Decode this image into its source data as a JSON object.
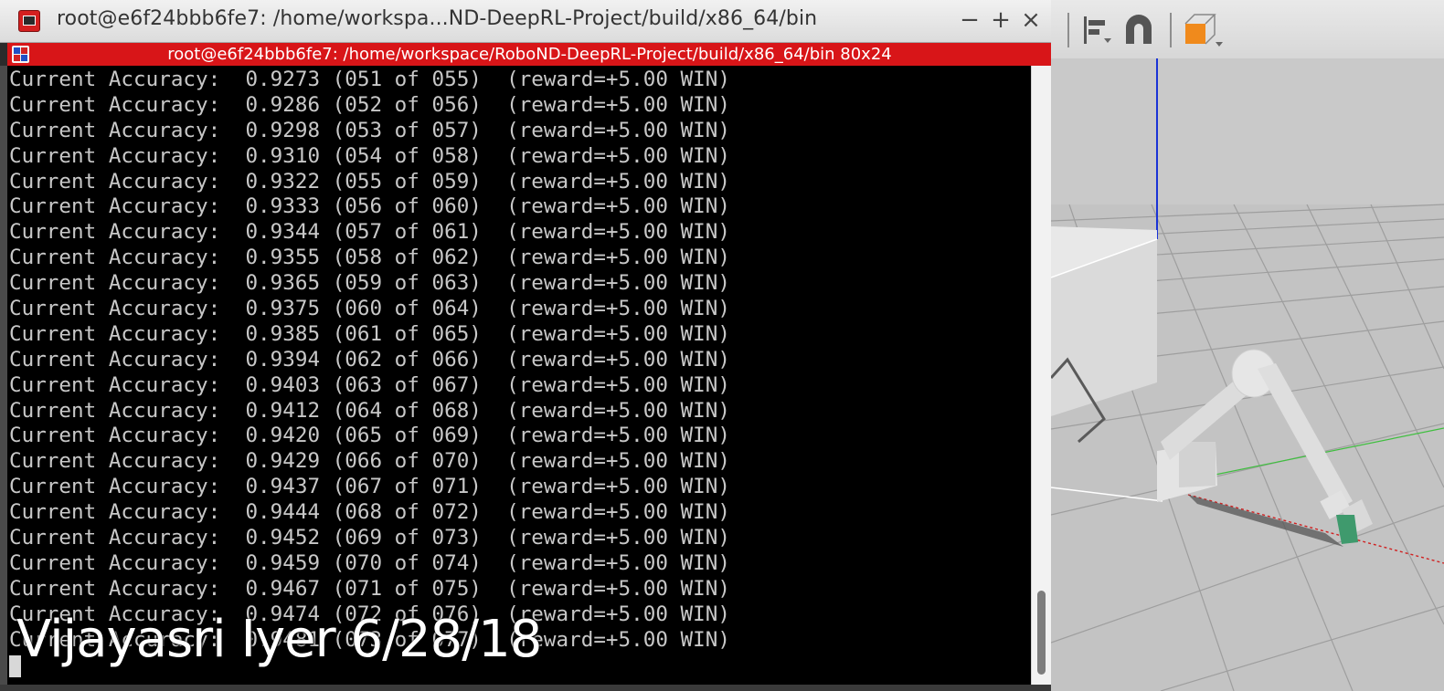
{
  "terminal": {
    "window_title": "root@e6f24bbb6fe7: /home/workspa...ND-DeepRL-Project/build/x86_64/bin",
    "controls": {
      "minimize": "−",
      "maximize": "+",
      "close": "×"
    },
    "tab_title": "root@e6f24bbb6fe7: /home/workspace/RoboND-DeepRL-Project/build/x86_64/bin 80x24",
    "lines": [
      "Current Accuracy:  0.9273 (051 of 055)  (reward=+5.00 WIN)",
      "Current Accuracy:  0.9286 (052 of 056)  (reward=+5.00 WIN)",
      "Current Accuracy:  0.9298 (053 of 057)  (reward=+5.00 WIN)",
      "Current Accuracy:  0.9310 (054 of 058)  (reward=+5.00 WIN)",
      "Current Accuracy:  0.9322 (055 of 059)  (reward=+5.00 WIN)",
      "Current Accuracy:  0.9333 (056 of 060)  (reward=+5.00 WIN)",
      "Current Accuracy:  0.9344 (057 of 061)  (reward=+5.00 WIN)",
      "Current Accuracy:  0.9355 (058 of 062)  (reward=+5.00 WIN)",
      "Current Accuracy:  0.9365 (059 of 063)  (reward=+5.00 WIN)",
      "Current Accuracy:  0.9375 (060 of 064)  (reward=+5.00 WIN)",
      "Current Accuracy:  0.9385 (061 of 065)  (reward=+5.00 WIN)",
      "Current Accuracy:  0.9394 (062 of 066)  (reward=+5.00 WIN)",
      "Current Accuracy:  0.9403 (063 of 067)  (reward=+5.00 WIN)",
      "Current Accuracy:  0.9412 (064 of 068)  (reward=+5.00 WIN)",
      "Current Accuracy:  0.9420 (065 of 069)  (reward=+5.00 WIN)",
      "Current Accuracy:  0.9429 (066 of 070)  (reward=+5.00 WIN)",
      "Current Accuracy:  0.9437 (067 of 071)  (reward=+5.00 WIN)",
      "Current Accuracy:  0.9444 (068 of 072)  (reward=+5.00 WIN)",
      "Current Accuracy:  0.9452 (069 of 073)  (reward=+5.00 WIN)",
      "Current Accuracy:  0.9459 (070 of 074)  (reward=+5.00 WIN)",
      "Current Accuracy:  0.9467 (071 of 075)  (reward=+5.00 WIN)",
      "Current Accuracy:  0.9474 (072 of 076)  (reward=+5.00 WIN)",
      "Current Accuracy:  0.9481 (073 of 077)  (reward=+5.00 WIN)"
    ]
  },
  "overlay": {
    "watermark": "Vijayasri Iyer 6/28/18"
  },
  "viewport": {
    "toolbar_icons": [
      "align-icon",
      "magnet-icon",
      "box-view-icon"
    ]
  },
  "colors": {
    "terminal_bg": "#000000",
    "terminal_text": "#c8c8c8",
    "inner_titlebar": "#d81518",
    "accent_box": "#f08a1c"
  }
}
